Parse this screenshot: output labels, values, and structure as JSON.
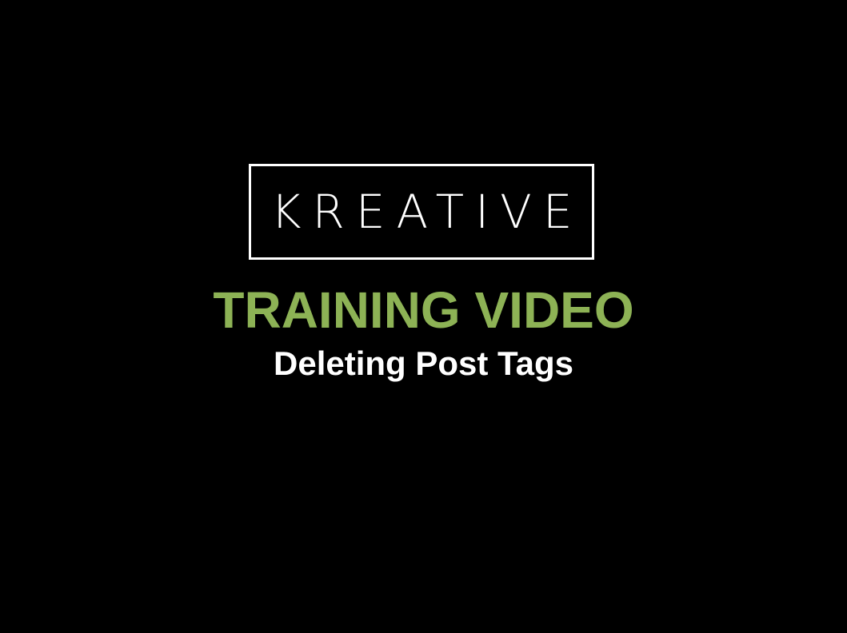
{
  "slide": {
    "logo_text": "KREATIVE",
    "title": "TRAINING VIDEO",
    "subtitle": "Deleting Post Tags"
  },
  "colors": {
    "background": "#000000",
    "title": "#8db255",
    "logo_and_subtitle": "#ffffff"
  }
}
